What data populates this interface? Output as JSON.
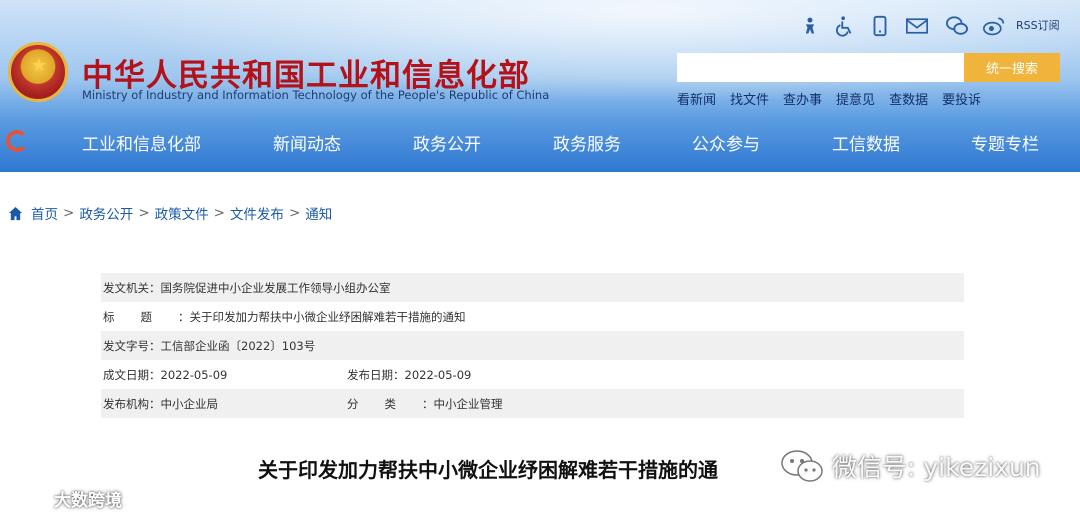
{
  "header": {
    "title": "中华人民共和国工业和信息化部",
    "subtitle": "Ministry of Industry and Information Technology of the People's Republic of China",
    "utility_icons": [
      "accessibility-icon",
      "wheelchair-icon",
      "mobile-icon",
      "mail-icon",
      "wechat-icon",
      "weibo-icon"
    ],
    "rss_label": "RSS订阅"
  },
  "search": {
    "value": "",
    "button_label": "统一搜索"
  },
  "quick_links": [
    "看新闻",
    "找文件",
    "查办事",
    "提意见",
    "查数据",
    "要投诉"
  ],
  "nav": {
    "items": [
      "工业和信息化部",
      "新闻动态",
      "政务公开",
      "政务服务",
      "公众参与",
      "工信数据",
      "专题专栏"
    ]
  },
  "breadcrumb": {
    "items": [
      "首页",
      "政务公开",
      "政策文件",
      "文件发布",
      "通知"
    ],
    "separator": ">"
  },
  "meta": {
    "issuer_label": "发文机关：",
    "issuer": "国务院促进中小企业发展工作领导小组办公室",
    "title_label": "标题：",
    "title": "关于印发加力帮扶中小微企业纾困解难若干措施的通知",
    "doc_no_label": "发文字号：",
    "doc_no": "工信部企业函〔2022〕103号",
    "written_label": "成文日期：",
    "written_date": "2022-05-09",
    "published_label": "发布日期：",
    "published_date": "2022-05-09",
    "agency_label": "发布机构：",
    "agency": "中小企业局",
    "category_label": "分类：",
    "category": "中小企业管理"
  },
  "document": {
    "title": "关于印发加力帮扶中小微企业纾困解难若干措施的通"
  },
  "watermarks": {
    "wechat": "微信号: yikezixun",
    "brand": "大数跨境"
  },
  "colors": {
    "title_red": "#b3121a",
    "search_button": "#f0b43c",
    "nav_blue": "#2f78d2",
    "link_blue": "#1c5aa8"
  }
}
